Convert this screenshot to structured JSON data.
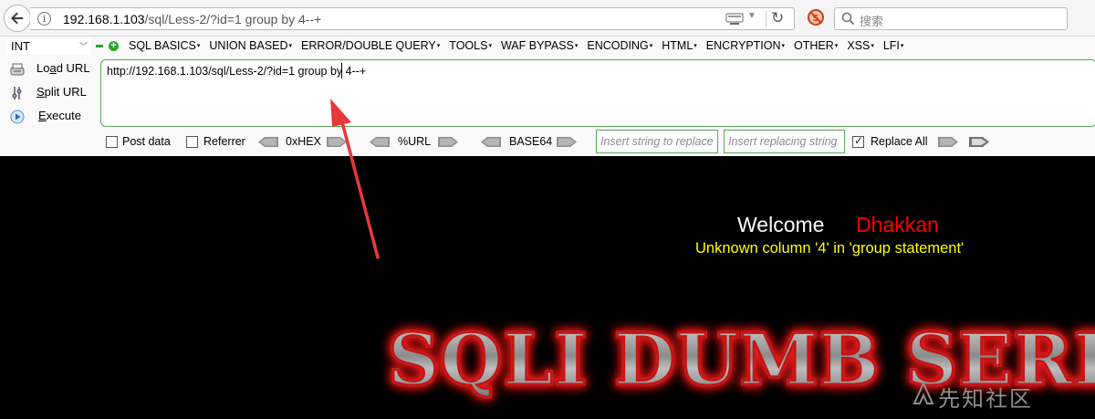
{
  "browser": {
    "url_host": "192.168.1.103",
    "url_path": "/sql/Less-2/?id=1 group by 4--+",
    "search_placeholder": "搜索"
  },
  "hackbar": {
    "mode_select": "INT",
    "menus": [
      "SQL BASICS",
      "UNION BASED",
      "ERROR/DOUBLE QUERY",
      "TOOLS",
      "WAF BYPASS",
      "ENCODING",
      "HTML",
      "ENCRYPTION",
      "OTHER",
      "XSS",
      "LFI"
    ],
    "actions": {
      "load_url_pre": "Lo",
      "load_url_u": "a",
      "load_url_post": "d URL",
      "split_url_pre": "",
      "split_url_u": "S",
      "split_url_post": "plit URL",
      "execute_pre": "",
      "execute_u": "E",
      "execute_post": "xecute"
    },
    "url_textarea": "http://192.168.1.103/sql/Less-2/?id=1 group by 4--+",
    "post_data_label": "Post data",
    "post_data_checked": false,
    "referrer_label": "Referrer",
    "referrer_checked": false,
    "enc_hex": "0xHEX",
    "enc_url": "%URL",
    "enc_base64": "BASE64",
    "replace_string_placeholder": "Insert string to replace",
    "replacing_string_placeholder": "Insert replacing string",
    "replace_all_label": "Replace All",
    "replace_all_checked": true
  },
  "page": {
    "welcome": "Welcome",
    "welcome_name": "Dhakkan",
    "error": "Unknown column '4' in 'group statement'",
    "banner": "SQLI DUMB SERIES",
    "watermark": "先知社区"
  },
  "colors": {
    "accent_green": "#5aa85a",
    "error_yellow": "#ffff00",
    "name_red": "#ff0000",
    "annotation_arrow": "#e8383a"
  }
}
